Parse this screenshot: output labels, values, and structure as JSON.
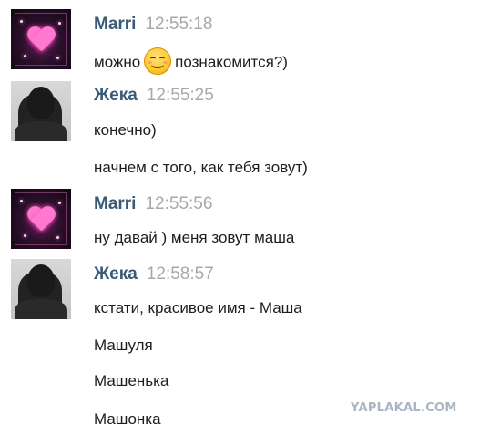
{
  "chat": {
    "groups": [
      {
        "sender": "Marri",
        "time": "12:55:18",
        "avatar": "heart-avatar",
        "messages": [
          {
            "before": "можно",
            "emoji": "smiley-icon",
            "after": "познакомится?)"
          }
        ]
      },
      {
        "sender": "Жека",
        "time": "12:55:25",
        "avatar": "photo-avatar",
        "messages": [
          {
            "text": "конечно)"
          },
          {
            "text": "начнем с того, как тебя зовут)"
          }
        ]
      },
      {
        "sender": "Marri",
        "time": "12:55:56",
        "avatar": "heart-avatar",
        "messages": [
          {
            "text": "ну давай ) меня зовут маша"
          }
        ]
      },
      {
        "sender": "Жека",
        "time": "12:58:57",
        "avatar": "photo-avatar",
        "messages": [
          {
            "text": "кстати, красивое имя - Маша"
          },
          {
            "text": "Машуля"
          },
          {
            "text": "Машенька"
          },
          {
            "text": "Машонка"
          }
        ]
      }
    ]
  },
  "watermark": "YAPLAKAL.COM",
  "colors": {
    "sender": "#3b5a78",
    "time": "#a8a8a8",
    "text": "#1e1e1e",
    "watermark": "#a9b6c2"
  }
}
